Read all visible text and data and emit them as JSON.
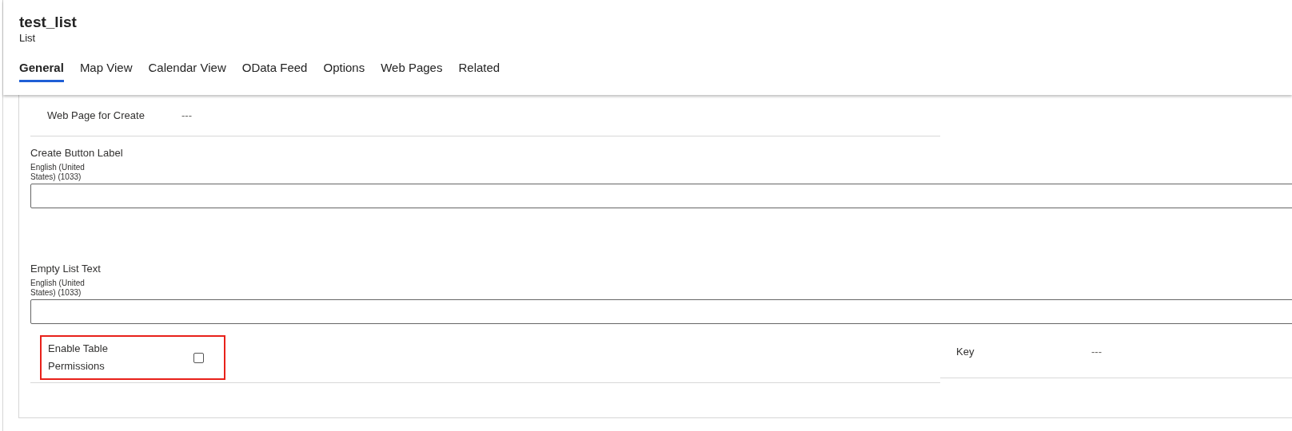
{
  "record": {
    "title": "test_list",
    "type": "List"
  },
  "tabs": [
    {
      "label": "General",
      "selected": true
    },
    {
      "label": "Map View",
      "selected": false
    },
    {
      "label": "Calendar View",
      "selected": false
    },
    {
      "label": "OData Feed",
      "selected": false
    },
    {
      "label": "Options",
      "selected": false
    },
    {
      "label": "Web Pages",
      "selected": false
    },
    {
      "label": "Related",
      "selected": false
    }
  ],
  "fields": [
    {
      "kind": "lookup",
      "label": "Web Page for Create",
      "value": "---"
    },
    {
      "kind": "localized",
      "label": "Create Button Label",
      "language": "English (United States) (1033)"
    },
    {
      "kind": "localized",
      "label": "Empty List Text",
      "language": "English (United States) (1033)"
    },
    {
      "kind": "checkbox",
      "label": "Enable Table Permissions",
      "checked": false,
      "highlighted": true,
      "side": {
        "label": "Key",
        "value": "---"
      }
    }
  ]
}
